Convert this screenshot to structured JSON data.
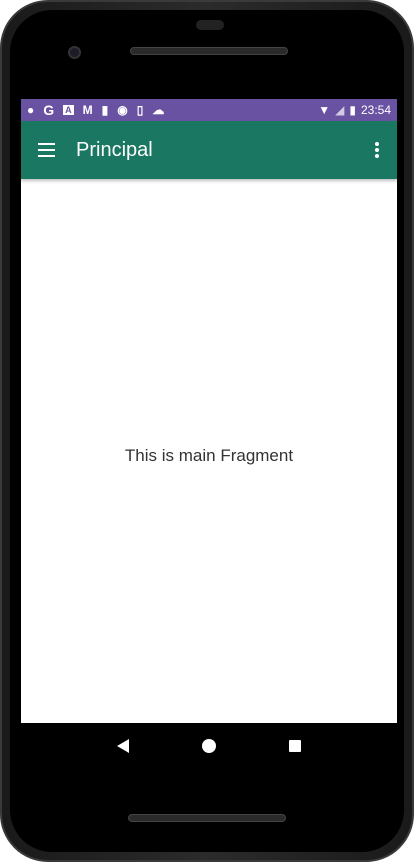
{
  "status_bar": {
    "time": "23:54",
    "icons": [
      "key-icon",
      "google-icon",
      "font-icon",
      "gmail-icon",
      "video-icon",
      "circle-icon",
      "sd-card-icon",
      "cloud-icon"
    ],
    "background": "#6a52a3"
  },
  "toolbar": {
    "title": "Principal",
    "background": "#1a7762"
  },
  "content": {
    "message": "This is main Fragment"
  }
}
